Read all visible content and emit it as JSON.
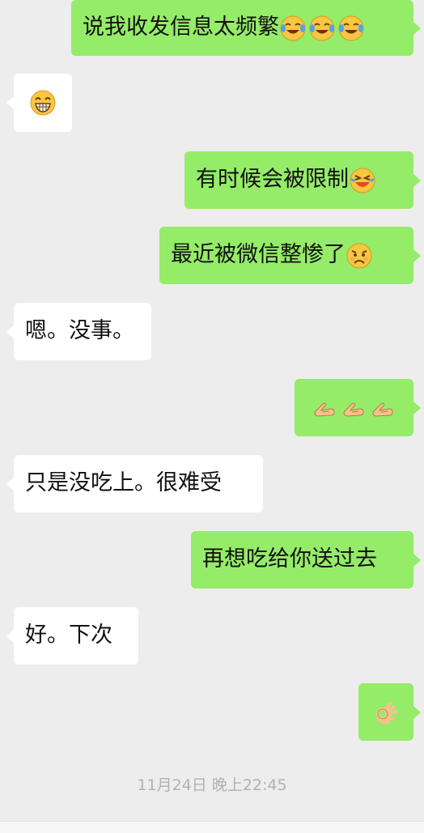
{
  "messages": [
    {
      "id": "m1",
      "side": "sent",
      "text": "说我收发信息太频繁",
      "emojis": [
        "laugh-cry-icon",
        "laugh-cry-icon",
        "laugh-cry-icon"
      ]
    },
    {
      "id": "m2",
      "side": "received",
      "text": "",
      "emojis": [
        "grin-icon"
      ]
    },
    {
      "id": "m3",
      "side": "sent",
      "text": "有时候会被限制",
      "emojis": [
        "tears-of-joy-icon"
      ]
    },
    {
      "id": "m4",
      "side": "sent",
      "text": "最近被微信整惨了",
      "emojis": [
        "frown-icon"
      ]
    },
    {
      "id": "m5",
      "side": "received",
      "text": "嗯。没事。",
      "emojis": []
    },
    {
      "id": "m6",
      "side": "sent",
      "text": "",
      "emojis": [
        "fist-bump-icon",
        "fist-bump-icon",
        "fist-bump-icon"
      ]
    },
    {
      "id": "m7",
      "side": "received",
      "text": "只是没吃上。很难受",
      "emojis": []
    },
    {
      "id": "m8",
      "side": "sent",
      "text": "再想吃给你送过去",
      "emojis": []
    },
    {
      "id": "m9",
      "side": "received",
      "text": "好。下次",
      "emojis": []
    },
    {
      "id": "m10",
      "side": "sent",
      "text": "",
      "emojis": [
        "ok-hand-icon"
      ]
    }
  ],
  "timestamp": "11月24日 晚上22:45",
  "colors": {
    "background": "#ededed",
    "sent_bubble": "#95ec69",
    "received_bubble": "#ffffff",
    "timestamp_text": "#b1b1b1"
  }
}
